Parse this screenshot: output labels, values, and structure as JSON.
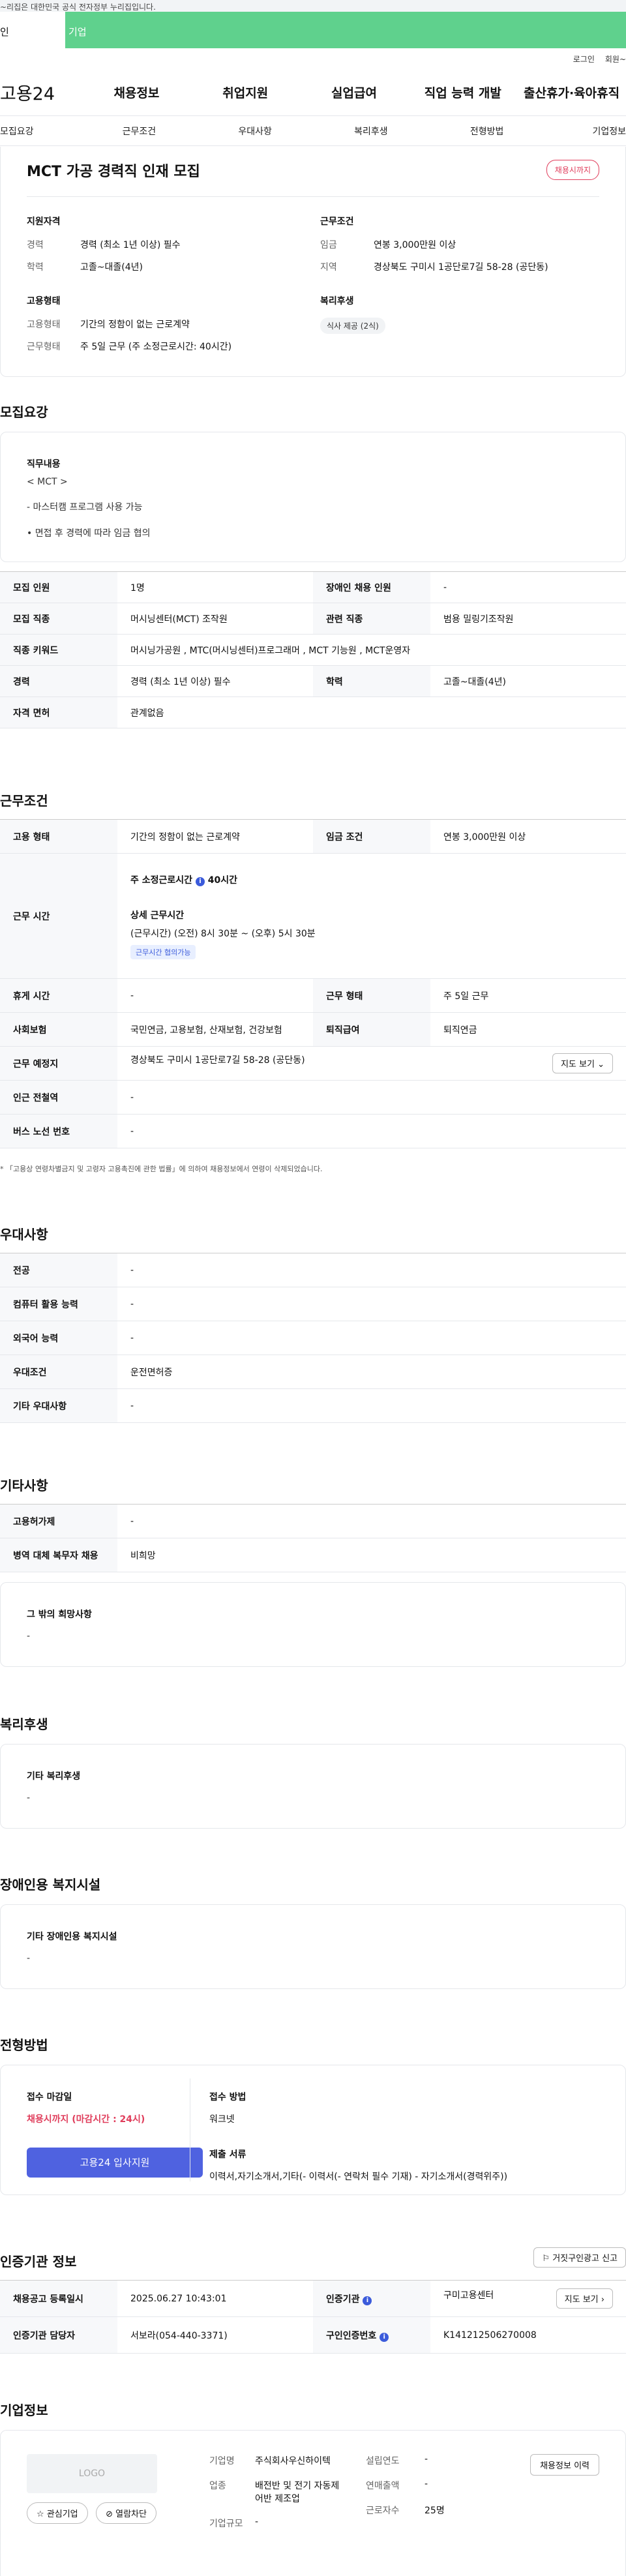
{
  "topbar": {
    "notice": "~리집은 대한민국 공식 전자정부 누리집입니다."
  },
  "tabs": {
    "a": "인",
    "b": "기업"
  },
  "util": {
    "login": "로그인",
    "join": "회원~"
  },
  "mainnav": {
    "logo": "고용24",
    "items": [
      "채용정보",
      "취업지원",
      "실업급여",
      "직업 능력 개발",
      "출산휴가·육아휴직"
    ]
  },
  "subnav": [
    "모집요강",
    "근무조건",
    "우대사항",
    "복리후생",
    "전형방법",
    "기업정보"
  ],
  "hero": {
    "title": "MCT 가공 경력직 인재 모집",
    "badge": "채용시까지",
    "qual": {
      "heading": "지원자격",
      "rows": [
        {
          "k": "경력",
          "v": "경력 (최소 1년 이상) 필수"
        },
        {
          "k": "학력",
          "v": "고졸~대졸(4년)"
        }
      ]
    },
    "cond": {
      "heading": "근무조건",
      "rows": [
        {
          "k": "임금",
          "v": "연봉 3,000만원 이상"
        },
        {
          "k": "지역",
          "v": "경상북도 구미시 1공단로7길 58-28 (공단동)"
        }
      ]
    },
    "emp": {
      "heading": "고용형태",
      "rows": [
        {
          "k": "고용형태",
          "v": "기간의 정함이 없는 근로계약"
        },
        {
          "k": "근무형태",
          "v": "주 5일 근무 (주 소정근로시간: 40시간)"
        }
      ]
    },
    "welfare": {
      "heading": "복리후생",
      "chip": "식사 제공 (2식)"
    }
  },
  "recruit": {
    "title": "모집요강",
    "job_heading": "직무내용",
    "job_lines": [
      "< MCT >",
      "- 마스터캠 프로그램 사용 가능",
      "• 면접 후 경력에 따라 임금 협의"
    ],
    "table": {
      "r1": [
        "모집 인원",
        "1명",
        "장애인 채용 인원",
        "-"
      ],
      "r2": [
        "모집 직종",
        "머시닝센터(MCT) 조작원",
        "관련 직종",
        "범용 밀링기조작원"
      ],
      "r3": [
        "직종 키워드",
        "머시닝가공원 , MTC(머시닝센터)프로그래머 , MCT 기능원 , MCT운영자"
      ],
      "r4": [
        "경력",
        "경력 (최소 1년 이상) 필수",
        "학력",
        "고졸~대졸(4년)"
      ],
      "r5": [
        "자격 면허",
        "관계없음"
      ]
    }
  },
  "work": {
    "title": "근무조건",
    "r1": [
      "고용 형태",
      "기간의 정함이 없는 근로계약",
      "임금 조건",
      "연봉 3,000만원 이상"
    ],
    "hours_label": "근무 시간",
    "hours_weekly_label": "주 소정근로시간",
    "hours_weekly": "40시간",
    "hours_detail_label": "상세 근무시간",
    "hours_detail": "(근무시간) (오전) 8시 30분 ~ (오후) 5시 30분",
    "hours_tag": "근무시간 협의가능",
    "r3": [
      "휴게 시간",
      "-",
      "근무 형태",
      "주 5일 근무"
    ],
    "r4": [
      "사회보험",
      "국민연금, 고용보험, 산재보험, 건강보험",
      "퇴직급여",
      "퇴직연금"
    ],
    "r5": [
      "근무 예정지",
      "경상북도 구미시 1공단로7길 58-28 (공단동)",
      "지도 보기"
    ],
    "r6": [
      "인근 전철역",
      "-"
    ],
    "r7": [
      "버스 노선 번호",
      "-"
    ],
    "note": "* 「고용상 연령차별금지 및 고령자 고용촉진에 관한 법률」에 의하여 채용정보에서 연령이 삭제되었습니다."
  },
  "pref": {
    "title": "우대사항",
    "rows": [
      [
        "전공",
        "-"
      ],
      [
        "컴퓨터 활용 능력",
        "-"
      ],
      [
        "외국어 능력",
        "-"
      ],
      [
        "우대조건",
        "운전면허증"
      ],
      [
        "기타 우대사항",
        "-"
      ]
    ]
  },
  "etc": {
    "title": "기타사항",
    "rows": [
      [
        "고용허가제",
        "-"
      ],
      [
        "병역 대체 복무자 채용",
        "비희망"
      ]
    ],
    "wish_heading": "그 밖의 희망사항",
    "wish_value": "-"
  },
  "benefit": {
    "title": "복리후생",
    "heading": "기타 복리후생",
    "value": "-"
  },
  "disability": {
    "title": "장애인용 복지시설",
    "heading": "기타 장애인용 복지시설",
    "value": "-"
  },
  "selection": {
    "title": "전형방법",
    "deadline_label": "접수 마감일",
    "deadline_value": "채용시까지 (마감시간 : 24시)",
    "apply_button": "고용24 입사지원",
    "method_label": "접수 방법",
    "method_value": "워크넷",
    "docs_label": "제출 서류",
    "docs_value": "이력서,자기소개서,기타(- 이력서(- 연락처 필수 기재) - 자기소개서(경력위주))"
  },
  "cert": {
    "title": "인증기관 정보",
    "report_button": "거짓구인광고 신고",
    "r1": [
      "채용공고 등록일시",
      "2025.06.27 10:43:01",
      "인증기관",
      "구미고용센터",
      "지도 보기"
    ],
    "r2": [
      "인증기관 담당자",
      "서보라(054-440-3371)",
      "구인인증번호",
      "K141212506270008"
    ]
  },
  "company": {
    "title": "기업정보",
    "logo": "LOGO",
    "fav": "관심기업",
    "block": "열람차단",
    "name_label": "기업명",
    "name_value": "주식회사우신하이텍",
    "industry_label": "업종",
    "industry_value": "배전반 및 전기 자동제어반 제조업",
    "size_label": "기업규모",
    "size_value": "-",
    "founded_label": "설립연도",
    "founded_value": "-",
    "sales_label": "연매출액",
    "sales_value": "-",
    "staff_label": "근로자수",
    "staff_value": "25명",
    "history_button": "채용정보 이력"
  }
}
